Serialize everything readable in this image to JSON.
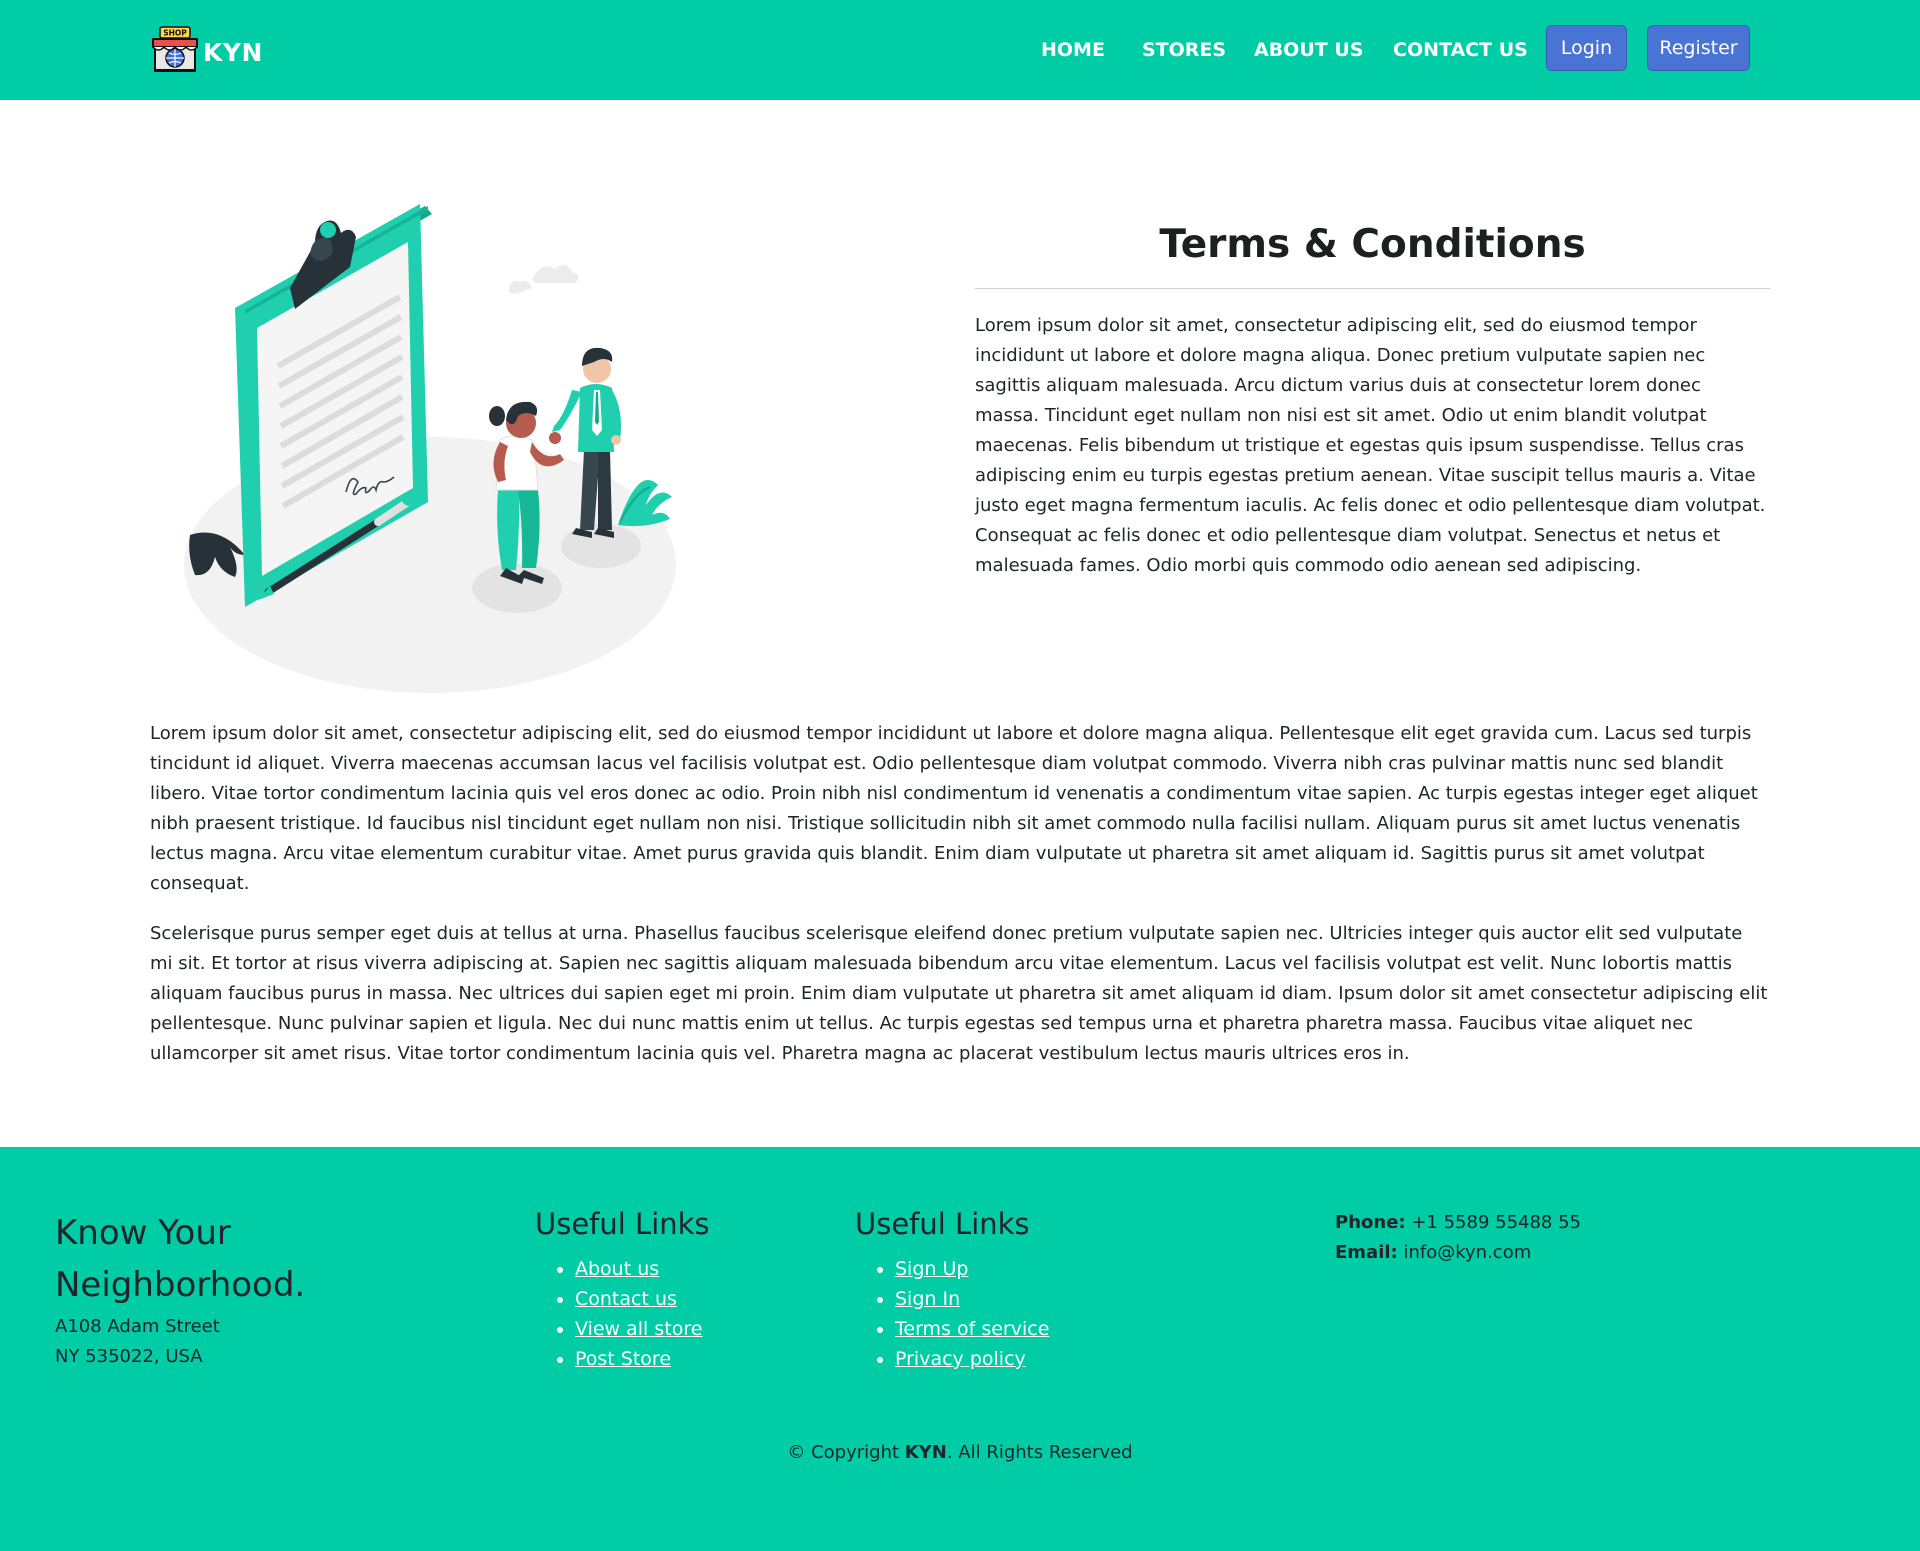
{
  "brand": {
    "name": "KYN",
    "logo_sign": "SHOP"
  },
  "nav": {
    "items": [
      "HOME",
      "STORES",
      "ABOUT US",
      "CONTACT US"
    ],
    "login": "Login",
    "register": "Register"
  },
  "terms": {
    "title": "Terms & Conditions",
    "body": "Lorem ipsum dolor sit amet, consectetur adipiscing elit, sed do eiusmod tempor incididunt ut labore et dolore magna aliqua. Donec pretium vulputate sapien nec sagittis aliquam malesuada. Arcu dictum varius duis at consectetur lorem donec massa. Tincidunt eget nullam non nisi est sit amet. Odio ut enim blandit volutpat maecenas. Felis bibendum ut tristique et egestas quis ipsum suspendisse. Tellus cras adipiscing enim eu turpis egestas pretium aenean. Vitae suscipit tellus mauris a. Vitae justo eget magna fermentum iaculis. Ac felis donec et odio pellentesque diam volutpat. Consequat ac felis donec et odio pellentesque diam volutpat. Senectus et netus et malesuada fames. Odio morbi quis commodo odio aenean sed adipiscing."
  },
  "paragraphs": [
    "Lorem ipsum dolor sit amet, consectetur adipiscing elit, sed do eiusmod tempor incididunt ut labore et dolore magna aliqua. Pellentesque elit eget gravida cum. Lacus sed turpis tincidunt id aliquet. Viverra maecenas accumsan lacus vel facilisis volutpat est. Odio pellentesque diam volutpat commodo. Viverra nibh cras pulvinar mattis nunc sed blandit libero. Vitae tortor condimentum lacinia quis vel eros donec ac odio. Proin nibh nisl condimentum id venenatis a condimentum vitae sapien. Ac turpis egestas integer eget aliquet nibh praesent tristique. Id faucibus nisl tincidunt eget nullam non nisi. Tristique sollicitudin nibh sit amet commodo nulla facilisi nullam. Aliquam purus sit amet luctus venenatis lectus magna. Arcu vitae elementum curabitur vitae. Amet purus gravida quis blandit. Enim diam vulputate ut pharetra sit amet aliquam id. Sagittis purus sit amet volutpat consequat.",
    "Scelerisque purus semper eget duis at tellus at urna. Phasellus faucibus scelerisque eleifend donec pretium vulputate sapien nec. Ultricies integer quis auctor elit sed vulputate mi sit. Et tortor at risus viverra adipiscing at. Sapien nec sagittis aliquam malesuada bibendum arcu vitae elementum. Lacus vel facilisis volutpat est velit. Nunc lobortis mattis aliquam faucibus purus in massa. Nec ultrices dui sapien eget mi proin. Enim diam vulputate ut pharetra sit amet aliquam id diam. Ipsum dolor sit amet consectetur adipiscing elit pellentesque. Nunc pulvinar sapien et ligula. Nec dui nunc mattis enim ut tellus. Ac turpis egestas sed tempus urna et pharetra pharetra massa. Faucibus vitae aliquet nec ullamcorper sit amet risus. Vitae tortor condimentum lacinia quis vel. Pharetra magna ac placerat vestibulum lectus mauris ultrices eros in."
  ],
  "footer": {
    "tagline": "Know Your Neighborhood.",
    "address_line1": "A108 Adam Street",
    "address_line2": "NY 535022, USA",
    "links1": {
      "heading": "Useful Links",
      "items": [
        "About us",
        "Contact us",
        "View all store",
        "Post Store"
      ]
    },
    "links2": {
      "heading": "Useful Links",
      "items": [
        "Sign Up",
        "Sign In",
        "Terms of service",
        "Privacy policy"
      ]
    },
    "phone_label": "Phone:",
    "phone": "+1 5589 55488 55",
    "email_label": "Email:",
    "email": "info@kyn.com",
    "copyright_prefix": "© Copyright",
    "copyright_brand": "KYN",
    "copyright_suffix": ". All Rights Reserved"
  },
  "colors": {
    "primary": "#00cca6",
    "button": "#4a74d4",
    "illustration_accent": "#1fcfae",
    "illustration_dark": "#263238"
  },
  "icons": {
    "logo": "shop-store-icon",
    "illustration": "contract-handshake-illustration"
  }
}
